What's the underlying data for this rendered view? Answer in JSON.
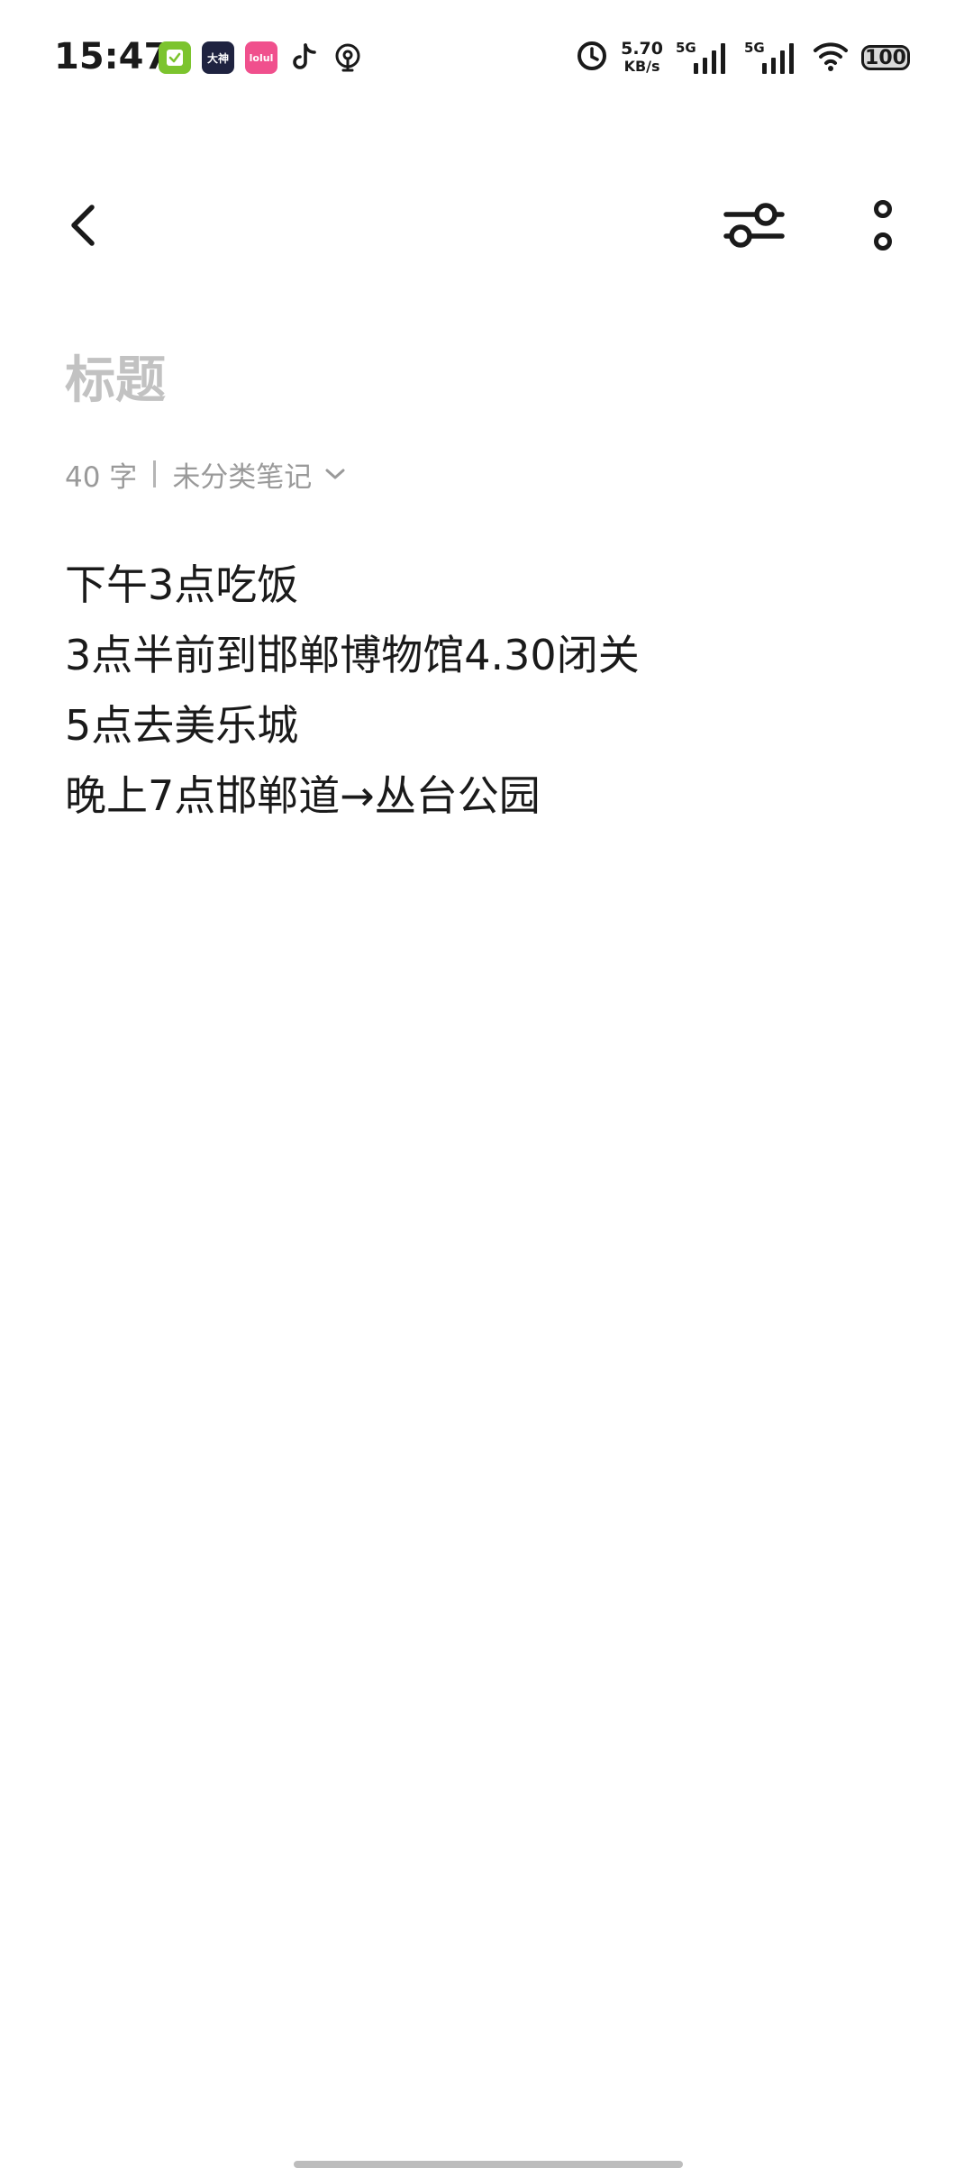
{
  "status_bar": {
    "time": "15:47",
    "notification_apps": [
      {
        "name": "checklist-app",
        "label": ""
      },
      {
        "name": "dashen-app",
        "label": "大神"
      },
      {
        "name": "pink-app",
        "label": "lolul"
      }
    ],
    "net_speed_value": "5.70",
    "net_speed_unit": "KB/s",
    "sim1_tag": "5G",
    "sim2_tag": "5G",
    "battery": "100"
  },
  "editor": {
    "title_placeholder": "标题",
    "title_value": "",
    "word_count": "40 字",
    "category": "未分类笔记",
    "lines": [
      "下午3点吃饭",
      "3点半前到邯郸博物馆4.30闭关",
      "5点去美乐城",
      "晚上7点邯郸道→丛台公园"
    ]
  }
}
